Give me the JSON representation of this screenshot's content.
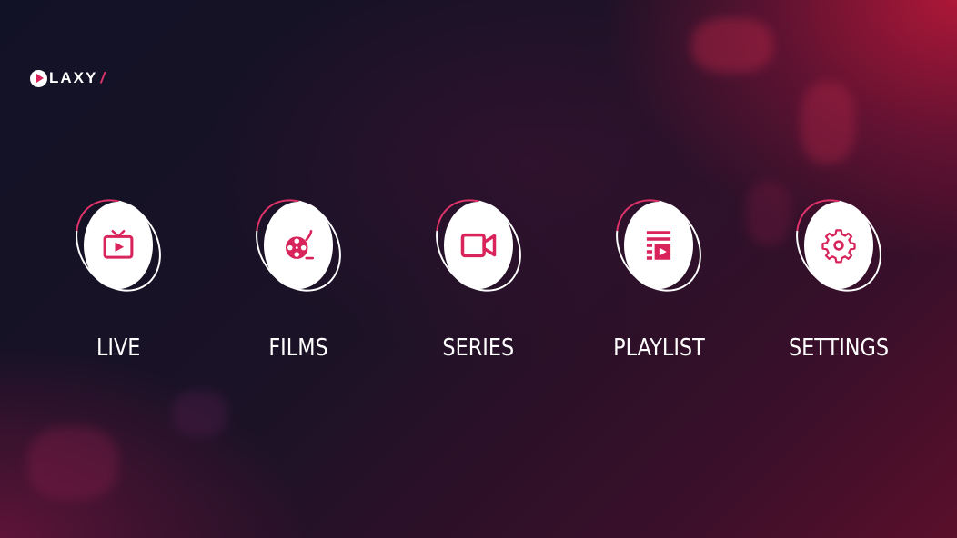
{
  "app": {
    "logo_text": "LAXY",
    "logo_accent": "/"
  },
  "colors": {
    "accent": "#d8245b",
    "icon": "#d8245b",
    "text": "#ffffff"
  },
  "menu": [
    {
      "label": "LIVE",
      "icon": "tv-icon"
    },
    {
      "label": "FILMS",
      "icon": "film-reel-icon"
    },
    {
      "label": "SERIES",
      "icon": "video-camera-icon"
    },
    {
      "label": "PLAYLIST",
      "icon": "playlist-icon"
    },
    {
      "label": "SETTINGS",
      "icon": "gear-icon"
    }
  ]
}
